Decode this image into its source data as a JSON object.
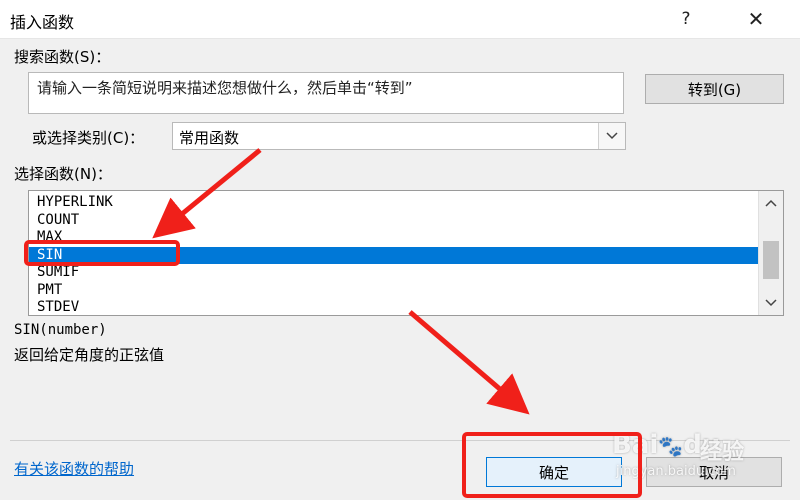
{
  "window": {
    "title": "插入函数",
    "help_glyph": "?",
    "close_glyph": "✕"
  },
  "search": {
    "label": "搜索函数(S)：",
    "placeholder": "请输入一条简短说明来描述您想做什么，然后单击“转到”",
    "goto_label": "转到(G)"
  },
  "category": {
    "label": "或选择类别(C)：",
    "selected": "常用函数"
  },
  "functions": {
    "label": "选择函数(N)：",
    "items": [
      "HYPERLINK",
      "COUNT",
      "MAX",
      "SIN",
      "SUMIF",
      "PMT",
      "STDEV"
    ],
    "selected_index": 3
  },
  "details": {
    "signature": "SIN(number)",
    "description": "返回给定角度的正弦值"
  },
  "footer": {
    "help_link": "有关该函数的帮助",
    "ok_label": "确定",
    "cancel_label": "取消"
  },
  "watermark": {
    "brand": "Bai",
    "brand_suffix": "du",
    "jingyan": "经验",
    "url": "jingyan.baidu.com"
  },
  "colors": {
    "selection": "#0078d7",
    "annotation": "#f0201a",
    "link": "#0066cc"
  }
}
